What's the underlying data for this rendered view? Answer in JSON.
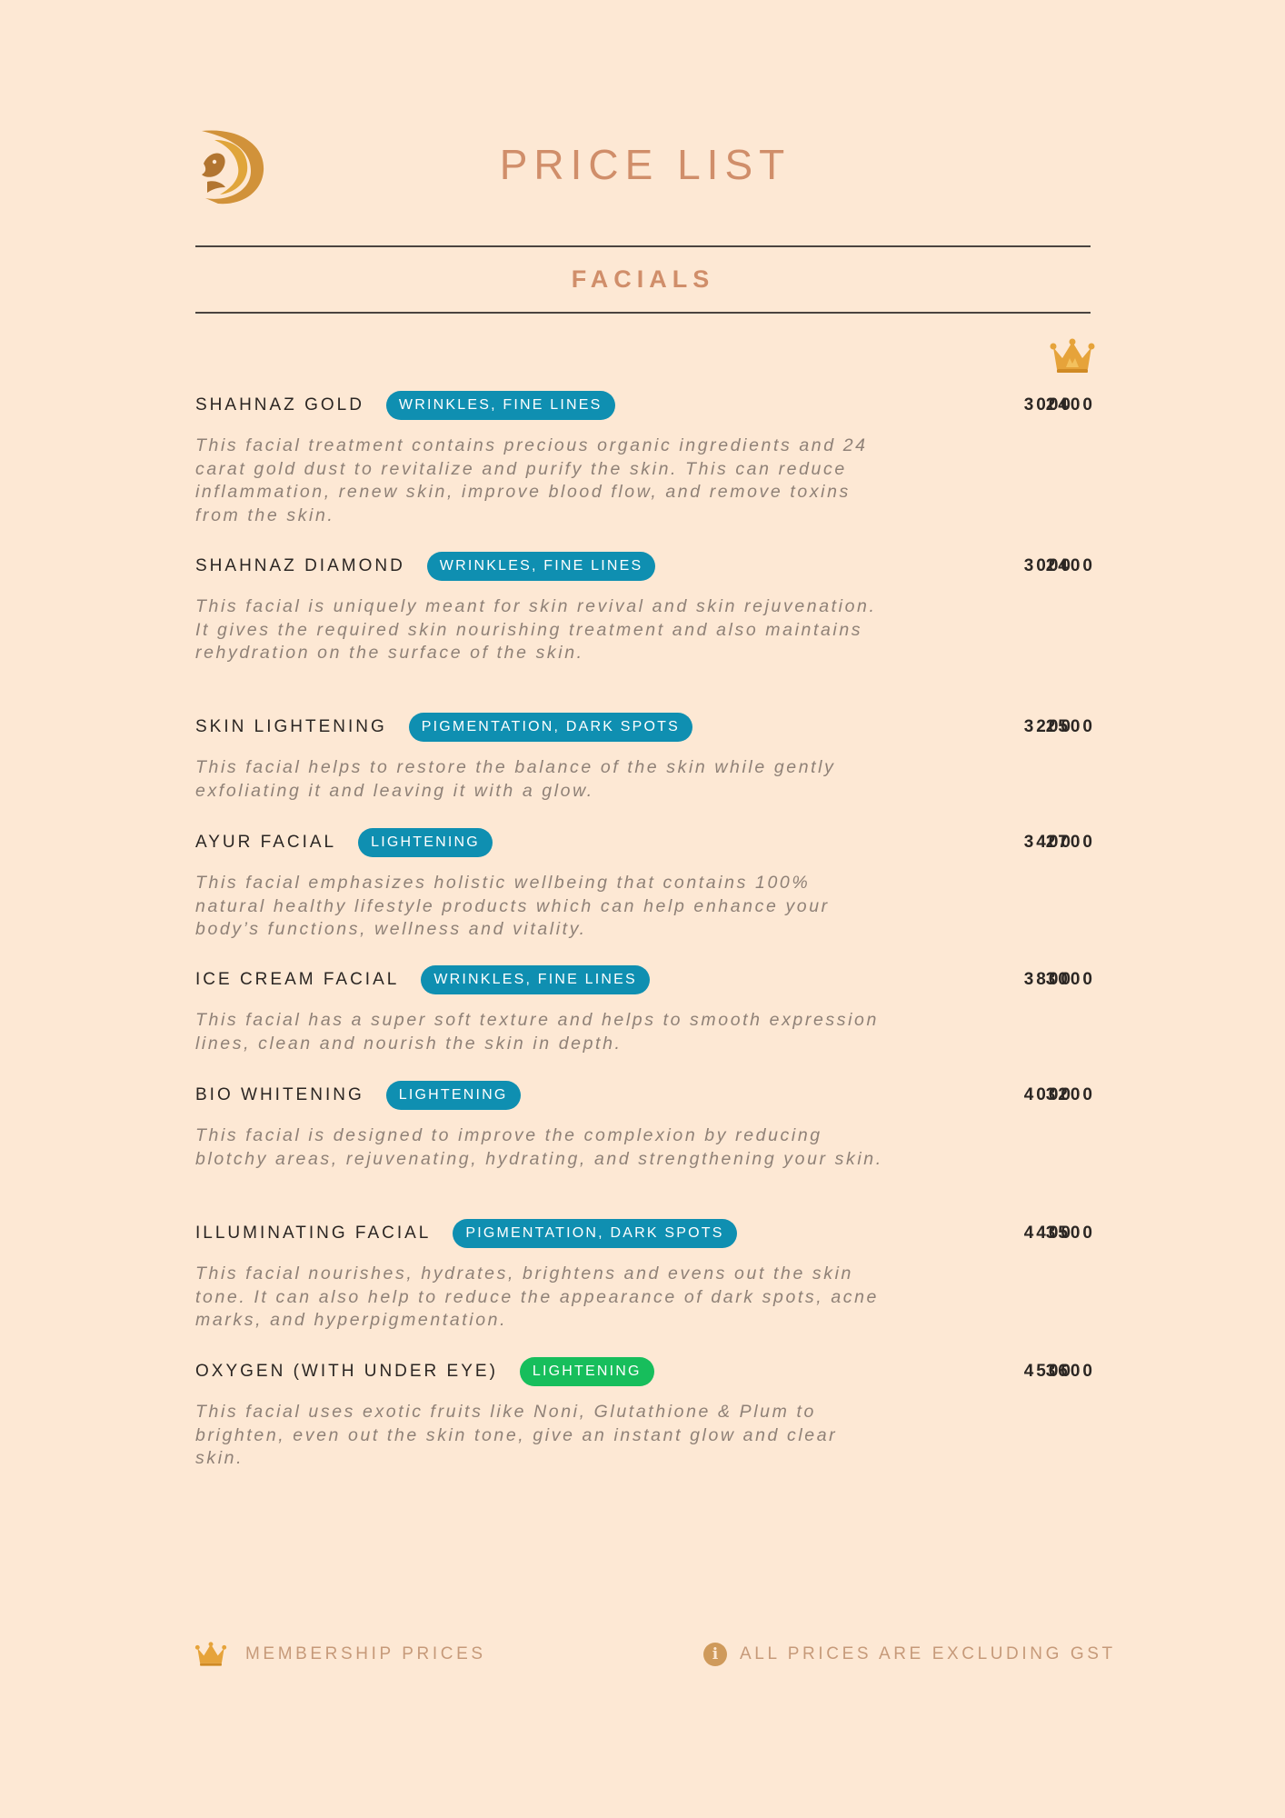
{
  "header": {
    "title": "PRICE LIST",
    "logo_icon": "stylized-d-lion-logo"
  },
  "section": {
    "title": "FACIALS",
    "member_column_icon": "crown-icon"
  },
  "colors": {
    "background": "#fde8d4",
    "accent": "#d08e6a",
    "tag_blue": "#0f8fb1",
    "tag_green": "#17be5c",
    "gold": "#e0a53a"
  },
  "items": [
    {
      "name": "SHAHNAZ GOLD",
      "tag": "WRINKLES, FINE LINES",
      "tag_color": "blue",
      "price": "3000",
      "member_price": "2400",
      "description": "This facial treatment contains precious organic ingredients and 24 carat gold dust to revitalize and purify the skin. This can reduce inflammation, renew skin, improve blood flow, and remove toxins from the skin."
    },
    {
      "name": "SHAHNAZ DIAMOND",
      "tag": "WRINKLES, FINE LINES",
      "tag_color": "blue",
      "price": "3000",
      "member_price": "2400",
      "description": "This facial is uniquely meant for skin revival and skin rejuvenation. It gives the required skin nourishing treatment and also maintains rehydration on the surface of the skin."
    },
    {
      "name": "SKIN LIGHTENING",
      "tag": "PIGMENTATION, DARK SPOTS",
      "tag_color": "blue",
      "price": "3200",
      "member_price": "2500",
      "description": "This facial helps to restore the balance of the skin while gently exfoliating it and leaving it with a glow."
    },
    {
      "name": "AYUR FACIAL",
      "tag": "LIGHTENING",
      "tag_color": "blue",
      "price": "3400",
      "member_price": "2700",
      "description": "This facial emphasizes holistic wellbeing that contains 100% natural healthy lifestyle products which can help enhance your body’s functions, wellness and vitality."
    },
    {
      "name": "ICE CREAM FACIAL",
      "tag": "WRINKLES, FINE LINES",
      "tag_color": "blue",
      "price": "3800",
      "member_price": "3000",
      "description": "This facial has a super soft texture and helps to smooth expression lines, clean and nourish the skin in depth."
    },
    {
      "name": "BIO WHITENING",
      "tag": "LIGHTENING",
      "tag_color": "blue",
      "price": "4000",
      "member_price": "3200",
      "description": "This facial is designed to improve the complexion by reducing blotchy areas, rejuvenating, hydrating, and strengthening your skin."
    },
    {
      "name": "ILLUMINATING FACIAL",
      "tag": "PIGMENTATION, DARK SPOTS",
      "tag_color": "blue",
      "price": "4400",
      "member_price": "3500",
      "description": "This facial nourishes, hydrates, brightens and evens out the skin tone. It can also help to reduce the appearance of dark spots, acne marks, and hyperpigmentation."
    },
    {
      "name": "OXYGEN (WITH UNDER EYE)",
      "tag": "LIGHTENING",
      "tag_color": "green",
      "price": "4500",
      "member_price": "3600",
      "description": "This facial uses exotic fruits like Noni, Glutathione & Plum to brighten, even out the skin tone, give an instant glow and clear skin."
    }
  ],
  "footer": {
    "membership_label": "MEMBERSHIP PRICES",
    "membership_icon": "crown-icon",
    "gst_note": "ALL PRICES ARE EXCLUDING GST",
    "gst_icon": "info-icon",
    "info_glyph": "i"
  }
}
